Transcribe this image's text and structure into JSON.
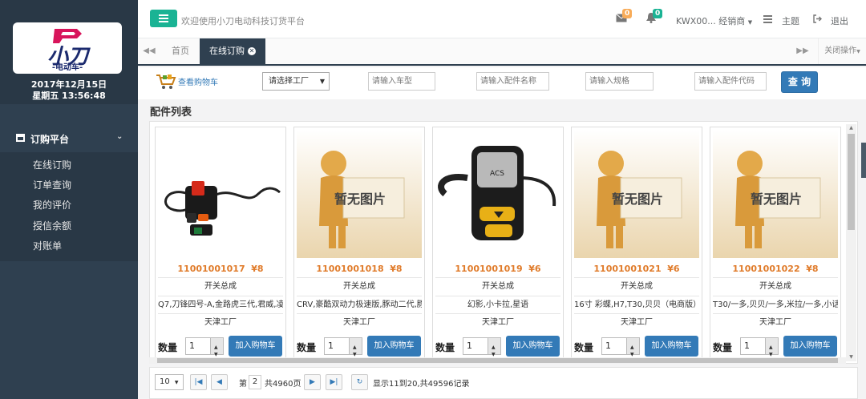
{
  "brand": {
    "logo_big": "小刀",
    "logo_small": "-电动车-"
  },
  "clock": {
    "date": "2017年12月15日",
    "time": "星期五 13:56:48"
  },
  "sidebar": {
    "menu_title": "订购平台",
    "items": [
      {
        "label": "在线订购"
      },
      {
        "label": "订单查询"
      },
      {
        "label": "我的评价"
      },
      {
        "label": "授信余额"
      },
      {
        "label": "对账单"
      }
    ]
  },
  "header": {
    "welcome": "欢迎使用小刀电动科技订货平台",
    "mail_badge": "0",
    "bell_badge": "0",
    "user": "KWX00... 经销商",
    "theme": "主题",
    "logout": "退出"
  },
  "tabs": {
    "items": [
      {
        "label": "首页"
      },
      {
        "label": "在线订购"
      }
    ],
    "close_ops": "关闭操作"
  },
  "search": {
    "cart_link": "查看购物车",
    "factory_select": "请选择工厂",
    "model_placeholder": "请输入车型",
    "part_name_placeholder": "请输入配件名称",
    "spec_placeholder": "请输入规格",
    "part_code_placeholder": "请输入配件代码",
    "query_button": "查 询"
  },
  "parts": {
    "section_title": "配件列表",
    "qty_label": "数量",
    "add_button": "加入购物车",
    "no_image_text": "暂无图片",
    "cards": [
      {
        "code": "11001001017",
        "price": "¥8",
        "name": "开关总成",
        "models": "Q7,刀锋四号-A,金路虎三代,君威,凌...",
        "factory": "天津工厂",
        "qty": "1"
      },
      {
        "code": "11001001018",
        "price": "¥8",
        "name": "开关总成",
        "models": "CRV,豪酷双动力极速版,豚动二代,豚...",
        "factory": "天津工厂",
        "qty": "1"
      },
      {
        "code": "11001001019",
        "price": "¥6",
        "name": "开关总成",
        "models": "幻影,小卡拉,星语",
        "factory": "天津工厂",
        "qty": "1"
      },
      {
        "code": "11001001021",
        "price": "¥6",
        "name": "开关总成",
        "models": "16寸 彩蝶,H7,T30,贝贝（电商版）,...",
        "factory": "天津工厂",
        "qty": "1"
      },
      {
        "code": "11001001022",
        "price": "¥8",
        "name": "开关总成",
        "models": "T30/一多,贝贝/一多,米拉/一多,小话...",
        "factory": "天津工厂",
        "qty": "1"
      }
    ]
  },
  "pagination": {
    "page_size": "10",
    "page_prefix": "第",
    "current_page": "2",
    "total_pages": "共4960页",
    "summary": "显示11到20,共49596记录"
  },
  "colors": {
    "sidebar": "#2f4050",
    "accent": "#1ab394",
    "primary": "#337ab7",
    "price": "#e07b2a"
  }
}
